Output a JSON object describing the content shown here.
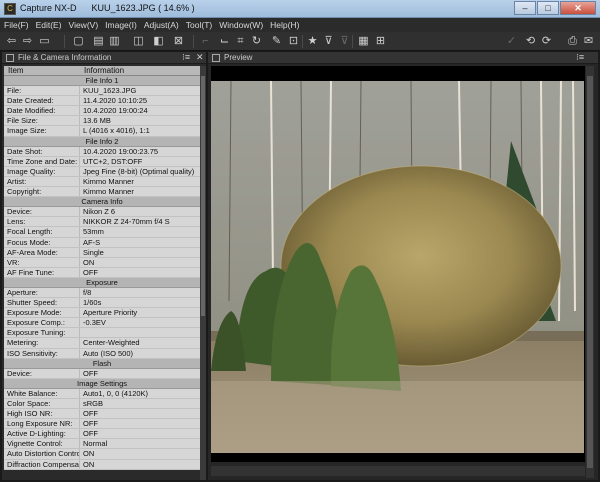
{
  "window": {
    "app": "Capture NX-D",
    "file": "KUU_1623.JPG ( 14.6% )",
    "min": "–",
    "max": "□",
    "close": "✕"
  },
  "menu": [
    "File(F)",
    "Edit(E)",
    "View(V)",
    "Image(I)",
    "Adjust(A)",
    "Tool(T)",
    "Window(W)",
    "Help(H)"
  ],
  "left_panel": {
    "title": "File & Camera Information",
    "col_item": "Item",
    "col_info": "Information"
  },
  "info_rows": [
    {
      "section": "File Info 1"
    },
    {
      "k": "File:",
      "v": "KUU_1623.JPG"
    },
    {
      "k": "Date Created:",
      "v": "11.4.2020 10:10:25"
    },
    {
      "k": "Date Modified:",
      "v": "10.4.2020 19:00:24"
    },
    {
      "k": "File Size:",
      "v": "13.6 MB"
    },
    {
      "k": "Image Size:",
      "v": "L (4016 x 4016), 1:1"
    },
    {
      "section": "File Info 2"
    },
    {
      "k": "Date Shot:",
      "v": "10.4.2020 19:00:23.75"
    },
    {
      "k": "Time Zone and Date:",
      "v": "UTC+2, DST:OFF"
    },
    {
      "k": "Image Quality:",
      "v": "Jpeg Fine (8-bit) (Optimal quality)"
    },
    {
      "k": "Artist:",
      "v": "Kimmo Manner"
    },
    {
      "k": "Copyright:",
      "v": "Kimmo Manner"
    },
    {
      "section": "Camera Info"
    },
    {
      "k": "Device:",
      "v": "Nikon Z 6"
    },
    {
      "k": "Lens:",
      "v": "NIKKOR Z 24-70mm f/4 S"
    },
    {
      "k": "Focal Length:",
      "v": "53mm"
    },
    {
      "k": "Focus Mode:",
      "v": "AF-S"
    },
    {
      "k": "AF-Area Mode:",
      "v": "Single"
    },
    {
      "k": "VR:",
      "v": "ON"
    },
    {
      "k": "AF Fine Tune:",
      "v": "OFF"
    },
    {
      "section": "Exposure"
    },
    {
      "k": "Aperture:",
      "v": "f/8"
    },
    {
      "k": "Shutter Speed:",
      "v": "1/60s"
    },
    {
      "k": "Exposure Mode:",
      "v": "Aperture Priority"
    },
    {
      "k": "Exposure Comp.:",
      "v": "-0.3EV"
    },
    {
      "k": "Exposure Tuning:",
      "v": ""
    },
    {
      "k": "Metering:",
      "v": "Center-Weighted"
    },
    {
      "k": "ISO Sensitivity:",
      "v": "Auto (ISO 500)"
    },
    {
      "section": "Flash"
    },
    {
      "k": "Device:",
      "v": "OFF"
    },
    {
      "section": "Image Settings"
    },
    {
      "k": "White Balance:",
      "v": "Auto1, 0, 0 (4120K)"
    },
    {
      "k": "Color Space:",
      "v": "sRGB"
    },
    {
      "k": "High ISO NR:",
      "v": "OFF"
    },
    {
      "k": "Long Exposure NR:",
      "v": "OFF"
    },
    {
      "k": "Active D-Lighting:",
      "v": "OFF"
    },
    {
      "k": "Vignette Control:",
      "v": "Normal"
    },
    {
      "k": "Auto Distortion Control:",
      "v": "ON"
    },
    {
      "k": "Diffraction Compensation:",
      "v": "ON"
    }
  ],
  "preview": {
    "title": "Preview"
  }
}
